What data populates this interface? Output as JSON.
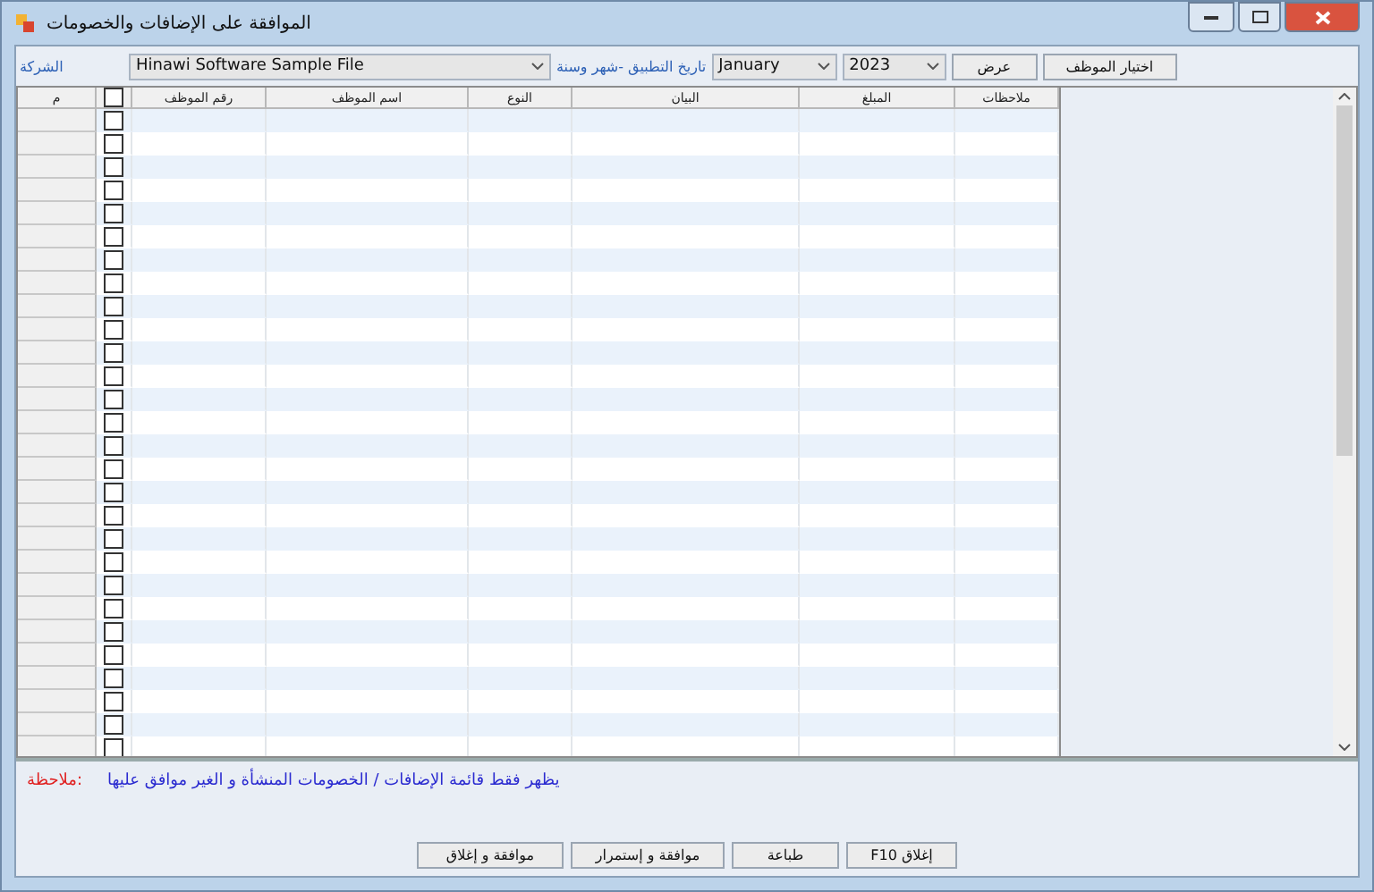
{
  "window": {
    "title": "الموافقة على الإضافات والخصومات"
  },
  "toolbar": {
    "company_label": "الشركة",
    "company": "Hinawi Software Sample File",
    "date_label": "تاريخ التطبيق -شهر وسنة",
    "month": "January",
    "year": "2023",
    "buttons": [
      "اختيار الموظف",
      "عرض"
    ]
  },
  "grid": {
    "header_checked": false,
    "columns": [
      "ملاحظات",
      "المبلغ",
      "البيان",
      "النوع",
      "اسم الموظف",
      "رقم الموظف",
      "م"
    ],
    "rows": [
      {
        "checked": false
      },
      {
        "checked": false
      },
      {
        "checked": false
      },
      {
        "checked": false
      },
      {
        "checked": false
      },
      {
        "checked": false
      },
      {
        "checked": false
      },
      {
        "checked": false
      },
      {
        "checked": false
      },
      {
        "checked": false
      },
      {
        "checked": false
      },
      {
        "checked": false
      },
      {
        "checked": false
      },
      {
        "checked": false
      },
      {
        "checked": false
      },
      {
        "checked": false
      },
      {
        "checked": false
      },
      {
        "checked": false
      },
      {
        "checked": false
      },
      {
        "checked": false
      },
      {
        "checked": false
      },
      {
        "checked": false
      },
      {
        "checked": false
      },
      {
        "checked": false
      },
      {
        "checked": false
      },
      {
        "checked": false
      },
      {
        "checked": false
      },
      {
        "checked": false
      }
    ]
  },
  "note": {
    "label": "ملاحظة:",
    "text": "يظهر فقط قائمة الإضافات / الخصومات المنشأة و الغير موافق عليها"
  },
  "buttons": [
    "F10 إغلاق",
    "طباعة",
    "موافقة و إستمرار",
    "موافقة و إغلاق"
  ]
}
